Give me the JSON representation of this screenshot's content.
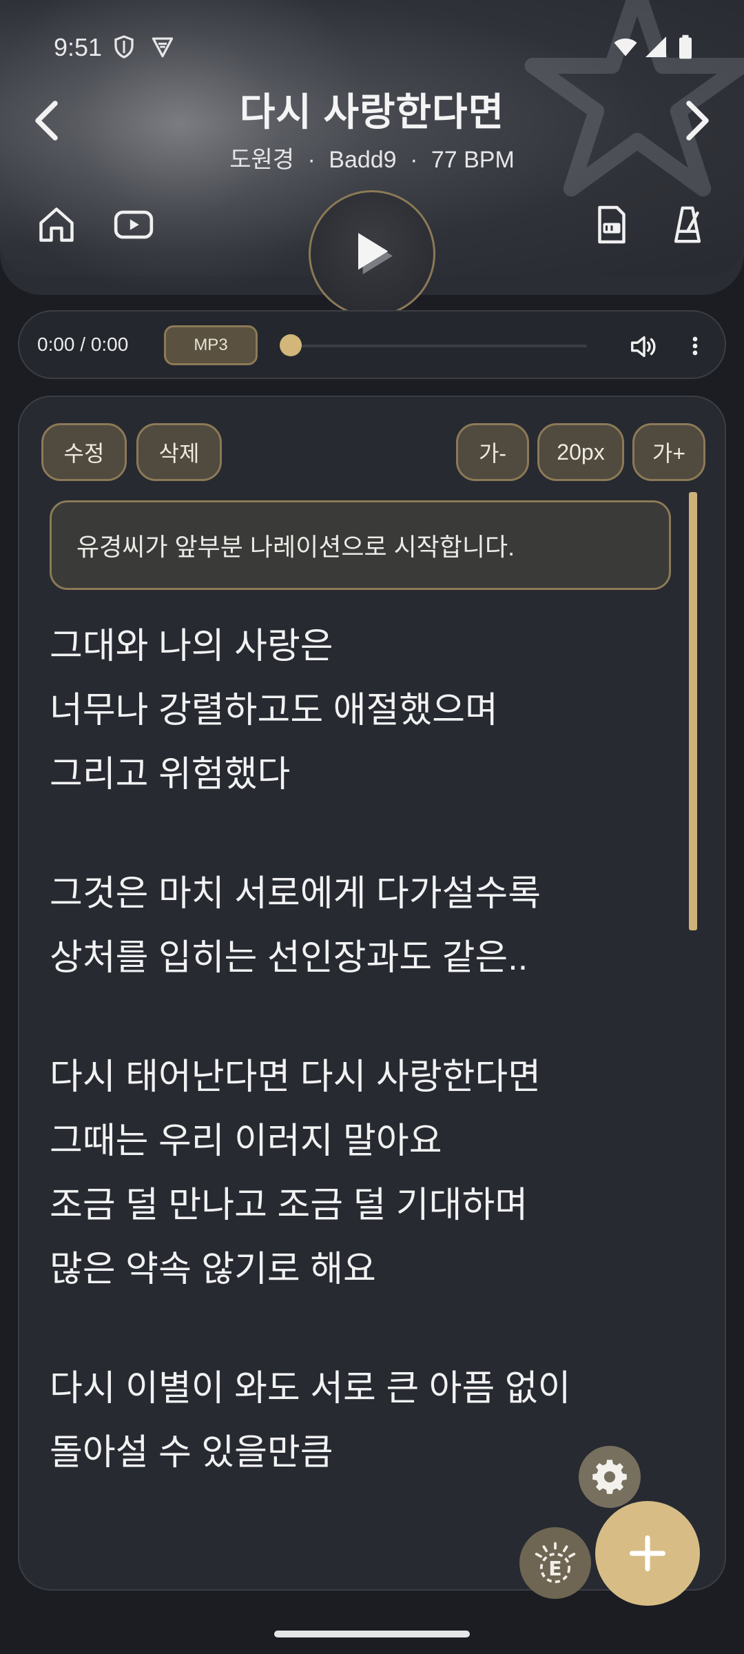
{
  "status": {
    "time": "9:51"
  },
  "song": {
    "title": "다시 사랑한다면",
    "artist": "도원경",
    "key": "Badd9",
    "bpm": "77 BPM",
    "sep": "·"
  },
  "player": {
    "time": "0:00 / 0:00",
    "format": "MP3",
    "progress": 0
  },
  "toolbar": {
    "edit": "수정",
    "delete": "삭제",
    "font_down": "가-",
    "font_size": "20px",
    "font_up": "가+"
  },
  "note": "유경씨가 앞부분 나레이션으로 시작합니다.",
  "lyrics": {
    "l1": "그대와 나의 사랑은",
    "l2": "너무나 강렬하고도 애절했으며",
    "l3": "그리고 위험했다",
    "l4": "그것은 마치 서로에게 다가설수록",
    "l5": "상처를 입히는 선인장과도 같은..",
    "l6": "다시 태어난다면 다시 사랑한다면",
    "l7": "그때는 우리 이러지 말아요",
    "l8": "조금 덜 만나고 조금 덜 기대하며",
    "l9": "많은 약속 않기로 해요",
    "l10": "다시 이별이 와도  서로 큰 아픔 없이",
    "l11": "돌아설 수 있을만큼"
  },
  "icons": {
    "back": "chevron-left-icon",
    "forward": "chevron-right-icon",
    "home": "home-icon",
    "video": "youtube-icon",
    "pdf": "pdf-icon",
    "metronome": "metronome-icon",
    "play": "play-icon",
    "volume": "volume-icon",
    "more": "more-vert-icon",
    "settings": "gear-icon",
    "e": "e-badge-icon",
    "add": "plus-icon"
  },
  "colors": {
    "accent": "#d7bd85",
    "pill_border": "#8c7a57",
    "background": "#1b1d22",
    "card": "#272a31"
  }
}
